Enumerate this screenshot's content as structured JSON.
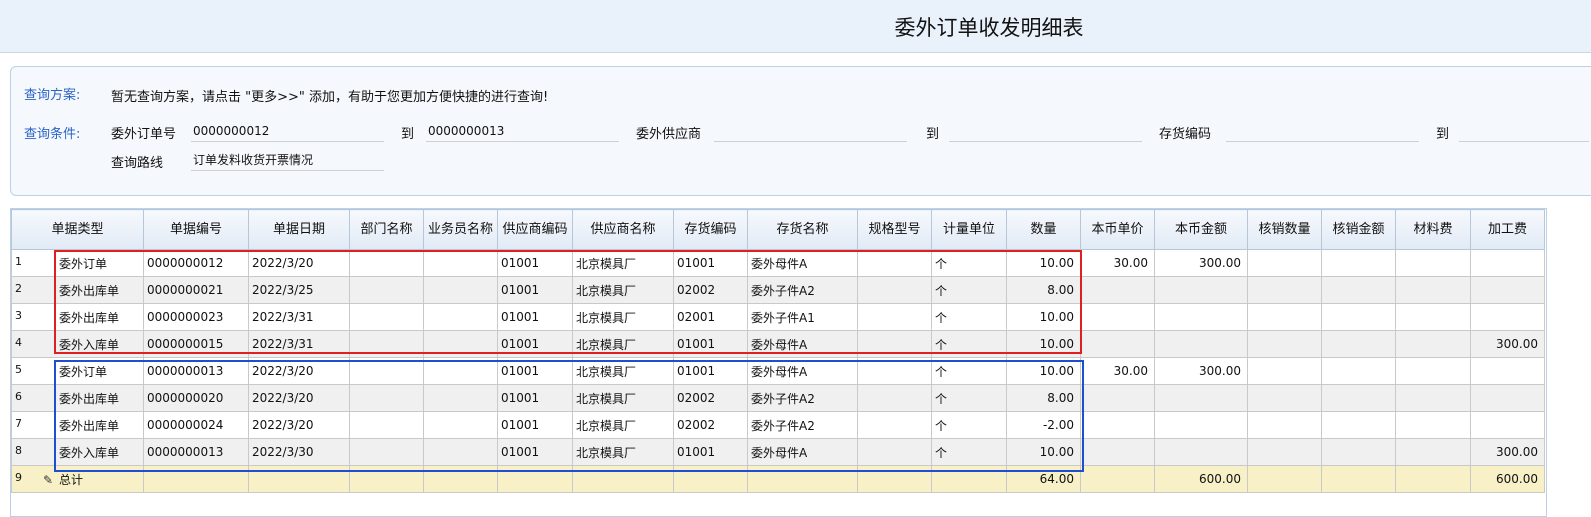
{
  "page_title": "委外订单收发明细表",
  "query": {
    "scheme_label": "查询方案:",
    "scheme_text": "暂无查询方案，请点击 \"更多>>\" 添加，有助于您更加方便快捷的进行查询!",
    "cond_label": "查询条件:",
    "order_no_label": "委外订单号",
    "order_no_from": "0000000012",
    "to_1": "到",
    "order_no_to": "0000000013",
    "supplier_label": "委外供应商",
    "supplier_from": "",
    "to_2": "到",
    "supplier_to": "",
    "inv_code_label": "存货编码",
    "inv_code_from": "",
    "to_3": "到",
    "route_label": "查询路线",
    "route_value": "订单发料收货开票情况"
  },
  "grid": {
    "columns": [
      "单据类型",
      "单据编号",
      "单据日期",
      "部门名称",
      "业务员名称",
      "供应商编码",
      "供应商名称",
      "存货编码",
      "存货名称",
      "规格型号",
      "计量单位",
      "数量",
      "本币单价",
      "本币金额",
      "核销数量",
      "核销金额",
      "材料费",
      "加工费"
    ],
    "rows": [
      {
        "n": "1",
        "type": "委外订单",
        "no": "0000000012",
        "date": "2022/3/20",
        "dept": "",
        "sales": "",
        "sup_code": "01001",
        "sup_name": "北京模具厂",
        "inv_code": "01001",
        "inv_name": "委外母件A",
        "spec": "",
        "unit": "个",
        "qty": "10.00",
        "price": "30.00",
        "amount": "300.00",
        "v_qty": "",
        "v_amt": "",
        "mat": "",
        "proc": ""
      },
      {
        "n": "2",
        "type": "委外出库单",
        "no": "0000000021",
        "date": "2022/3/25",
        "dept": "",
        "sales": "",
        "sup_code": "01001",
        "sup_name": "北京模具厂",
        "inv_code": "02002",
        "inv_name": "委外子件A2",
        "spec": "",
        "unit": "个",
        "qty": "8.00",
        "price": "",
        "amount": "",
        "v_qty": "",
        "v_amt": "",
        "mat": "",
        "proc": ""
      },
      {
        "n": "3",
        "type": "委外出库单",
        "no": "0000000023",
        "date": "2022/3/31",
        "dept": "",
        "sales": "",
        "sup_code": "01001",
        "sup_name": "北京模具厂",
        "inv_code": "02001",
        "inv_name": "委外子件A1",
        "spec": "",
        "unit": "个",
        "qty": "10.00",
        "price": "",
        "amount": "",
        "v_qty": "",
        "v_amt": "",
        "mat": "",
        "proc": ""
      },
      {
        "n": "4",
        "type": "委外入库单",
        "no": "0000000015",
        "date": "2022/3/31",
        "dept": "",
        "sales": "",
        "sup_code": "01001",
        "sup_name": "北京模具厂",
        "inv_code": "01001",
        "inv_name": "委外母件A",
        "spec": "",
        "unit": "个",
        "qty": "10.00",
        "price": "",
        "amount": "",
        "v_qty": "",
        "v_amt": "",
        "mat": "",
        "proc": "300.00"
      },
      {
        "n": "5",
        "type": "委外订单",
        "no": "0000000013",
        "date": "2022/3/20",
        "dept": "",
        "sales": "",
        "sup_code": "01001",
        "sup_name": "北京模具厂",
        "inv_code": "01001",
        "inv_name": "委外母件A",
        "spec": "",
        "unit": "个",
        "qty": "10.00",
        "price": "30.00",
        "amount": "300.00",
        "v_qty": "",
        "v_amt": "",
        "mat": "",
        "proc": ""
      },
      {
        "n": "6",
        "type": "委外出库单",
        "no": "0000000020",
        "date": "2022/3/20",
        "dept": "",
        "sales": "",
        "sup_code": "01001",
        "sup_name": "北京模具厂",
        "inv_code": "02002",
        "inv_name": "委外子件A2",
        "spec": "",
        "unit": "个",
        "qty": "8.00",
        "price": "",
        "amount": "",
        "v_qty": "",
        "v_amt": "",
        "mat": "",
        "proc": ""
      },
      {
        "n": "7",
        "type": "委外出库单",
        "no": "0000000024",
        "date": "2022/3/20",
        "dept": "",
        "sales": "",
        "sup_code": "01001",
        "sup_name": "北京模具厂",
        "inv_code": "02002",
        "inv_name": "委外子件A2",
        "spec": "",
        "unit": "个",
        "qty": "-2.00",
        "price": "",
        "amount": "",
        "v_qty": "",
        "v_amt": "",
        "mat": "",
        "proc": ""
      },
      {
        "n": "8",
        "type": "委外入库单",
        "no": "0000000013",
        "date": "2022/3/30",
        "dept": "",
        "sales": "",
        "sup_code": "01001",
        "sup_name": "北京模具厂",
        "inv_code": "01001",
        "inv_name": "委外母件A",
        "spec": "",
        "unit": "个",
        "qty": "10.00",
        "price": "",
        "amount": "",
        "v_qty": "",
        "v_amt": "",
        "mat": "",
        "proc": "300.00"
      }
    ],
    "total": {
      "n": "9",
      "label": "总计",
      "qty": "64.00",
      "amount": "600.00",
      "proc": "600.00"
    }
  },
  "highlight_colors": {
    "red_box": "#e02020",
    "blue_box": "#1f4fd1"
  }
}
